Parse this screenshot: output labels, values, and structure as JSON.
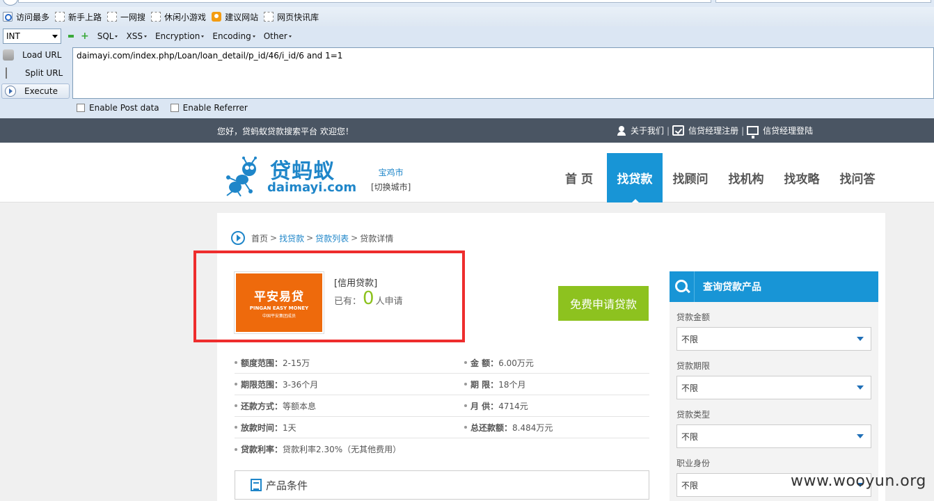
{
  "bookmarks": [
    {
      "label": "访问最多",
      "icon": "search-icon"
    },
    {
      "label": "新手上路",
      "icon": "blank-page-icon"
    },
    {
      "label": "一网搜",
      "icon": "blank-page-icon"
    },
    {
      "label": "休闲小游戏",
      "icon": "blank-page-icon"
    },
    {
      "label": "建议网站",
      "icon": "lightbulb-icon"
    },
    {
      "label": "网页快讯库",
      "icon": "blank-page-icon"
    }
  ],
  "hackbar": {
    "type_select": "INT",
    "menus": [
      "SQL",
      "XSS",
      "Encryption",
      "Encoding",
      "Other"
    ],
    "actions": {
      "load": "Load URL",
      "split": "Split URL",
      "execute": "Execute"
    },
    "url": "daimayi.com/index.php/Loan/loan_detail/p_id/46/i_id/6 and 1=1",
    "enable_post": "Enable Post data",
    "enable_referrer": "Enable Referrer"
  },
  "site": {
    "welcome": "您好，贷蚂蚁贷款搜索平台 欢迎您！",
    "top_links": [
      "关于我们",
      "信贷经理注册",
      "信贷经理登陆"
    ],
    "logo_cn": "贷蚂蚁",
    "logo_en": "daimayi.com",
    "city": "宝鸡市",
    "city_switch": "[切换城市]",
    "nav": [
      "首 页",
      "找贷款",
      "找顾问",
      "找机构",
      "找攻略",
      "找问答"
    ],
    "nav_active_index": 1,
    "accent_color": "#1895d6",
    "green_color": "#8dc21f"
  },
  "detail": {
    "breadcrumb": {
      "home": "首页",
      "c1": "找贷款",
      "c2": "贷款列表",
      "current": "贷款详情",
      "sep": ">"
    },
    "product_logo": {
      "line1": "平安易贷",
      "line2": "PINGAN EASY MONEY",
      "line3": "中国平安集团成员"
    },
    "product_type": "[信用贷款]",
    "count_prefix": "已有：",
    "count": "0",
    "count_suffix": "人申请",
    "apply_button": "免费申请贷款",
    "specs": [
      [
        {
          "k": "额度范围：",
          "v": "2-15万"
        },
        {
          "k": "金 额：",
          "v": "6.00万元"
        }
      ],
      [
        {
          "k": "期限范围：",
          "v": "3-36个月"
        },
        {
          "k": "期 限：",
          "v": "18个月"
        }
      ],
      [
        {
          "k": "还款方式：",
          "v": "等额本息"
        },
        {
          "k": "月 供：",
          "v": "4714元"
        }
      ],
      [
        {
          "k": "放款时间：",
          "v": "1天"
        },
        {
          "k": "总还款额：",
          "v": "8.484万元"
        }
      ],
      [
        {
          "k": "贷款利率：",
          "v": "贷款利率2.30%（无其他费用）"
        }
      ]
    ],
    "conditions_title": "产品条件"
  },
  "sidebar": {
    "title": "查询贷款产品",
    "filters": [
      {
        "label": "贷款金额",
        "value": "不限"
      },
      {
        "label": "贷款期限",
        "value": "不限"
      },
      {
        "label": "贷款类型",
        "value": "不限"
      },
      {
        "label": "职业身份",
        "value": "不限"
      }
    ]
  },
  "watermark": "www.wooyun.org"
}
